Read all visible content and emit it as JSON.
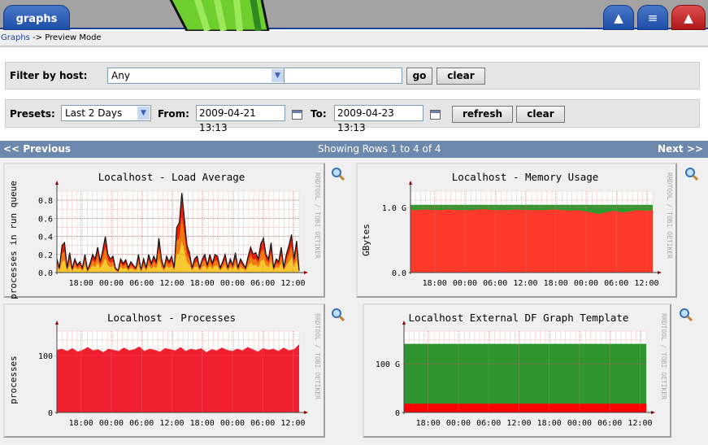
{
  "header": {
    "tab_label": "graphs",
    "icons": [
      "tree-icon",
      "list-icon",
      "graph-preview-icon"
    ]
  },
  "breadcrumb": {
    "link": "Graphs",
    "rest": " -> Preview Mode"
  },
  "filter": {
    "label": "Filter by host:",
    "host_value": "Any",
    "search_value": "",
    "go_label": "go",
    "clear_label": "clear"
  },
  "timespan": {
    "presets_label": "Presets:",
    "preset_value": "Last 2 Days",
    "from_label": "From:",
    "from_value": "2009-04-21 13:13",
    "to_label": "To:",
    "to_value": "2009-04-23 13:13",
    "refresh_label": "refresh",
    "clear_label": "clear"
  },
  "nav": {
    "previous": "<< Previous",
    "status": "Showing Rows 1 to 4 of 4",
    "next": "Next >>"
  },
  "colors": {
    "header_bg": "#a3a3a3",
    "nav_bg": "#6d88ad",
    "accent": "#1a3f9a"
  },
  "chart_data": [
    {
      "type": "area",
      "title": "Localhost - Load Average",
      "ylabel": "processes in run queue",
      "watermark": "RRDTOOL / TOBI OETIKER",
      "ylim": [
        0,
        0.9
      ],
      "yticks": [
        "0.0",
        "0.2",
        "0.4",
        "0.6",
        "0.8"
      ],
      "ytick_values": [
        0,
        0.2,
        0.4,
        0.6,
        0.8
      ],
      "xlim": [
        "2009-04-21 13:13",
        "2009-04-23 13:13"
      ],
      "xticks": [
        "18:00",
        "00:00",
        "06:00",
        "12:00",
        "18:00",
        "00:00",
        "06:00",
        "12:00"
      ],
      "values": [
        0.15,
        0.05,
        0.3,
        0.33,
        0.05,
        0.22,
        0.04,
        0.15,
        0.08,
        0.12,
        0.05,
        0.2,
        0.03,
        0.1,
        0.2,
        0.15,
        0.28,
        0.12,
        0.25,
        0.4,
        0.2,
        0.15,
        0.18,
        0.05,
        0.02,
        0.15,
        0.1,
        0.14,
        0.05,
        0.12,
        0.08,
        0.05,
        0.2,
        0.03,
        0.15,
        0.05,
        0.2,
        0.1,
        0.18,
        0.12,
        0.38,
        0.15,
        0.05,
        0.18,
        0.12,
        0.18,
        0.05,
        0.5,
        0.55,
        0.88,
        0.6,
        0.3,
        0.22,
        0.05,
        0.15,
        0.18,
        0.05,
        0.15,
        0.2,
        0.08,
        0.2,
        0.1,
        0.2,
        0.18,
        0.05,
        0.12,
        0.2,
        0.05,
        0.15,
        0.08,
        0.22,
        0.05,
        0.15,
        0.1,
        0.05,
        0.18,
        0.28,
        0.2,
        0.22,
        0.15,
        0.32,
        0.38,
        0.2,
        0.15,
        0.33,
        0.05,
        0.15,
        0.12,
        0.28,
        0.05,
        0.2,
        0.3,
        0.42,
        0.15,
        0.35,
        0.02
      ]
    },
    {
      "type": "area",
      "title": "Localhost - Memory Usage",
      "ylabel": "GBytes",
      "watermark": "RRDTOOL / TOBI OETIKER",
      "ylim": [
        0,
        1.25
      ],
      "yticks": [
        "0.0",
        "1.0 G"
      ],
      "ytick_values": [
        0,
        1.0
      ],
      "xlim": [
        "2009-04-21 13:13",
        "2009-04-23 13:13"
      ],
      "xticks": [
        "18:00",
        "00:00",
        "06:00",
        "12:00",
        "18:00",
        "00:00",
        "06:00",
        "12:00"
      ],
      "series": [
        {
          "color": "#ff3a2a",
          "values": [
            0.96,
            0.96,
            0.97,
            0.96,
            0.96,
            0.97,
            0.96,
            0.96,
            0.96,
            0.97,
            0.97,
            0.96,
            0.96,
            0.96,
            0.97,
            0.96,
            0.96,
            0.96,
            0.96,
            0.97,
            0.96,
            0.95,
            0.96,
            0.94,
            0.92,
            0.9,
            0.93,
            0.95,
            0.92,
            0.94,
            0.96,
            0.95,
            0.96
          ]
        },
        {
          "color": "#2f9a2f",
          "values": [
            1.04,
            1.04,
            1.04,
            1.04,
            1.04,
            1.04,
            1.04,
            1.04,
            1.04,
            1.04,
            1.04,
            1.04,
            1.04,
            1.04,
            1.04,
            1.04,
            1.04,
            1.04,
            1.04,
            1.04,
            1.04,
            1.04,
            1.04,
            1.04,
            1.04,
            1.04,
            1.04,
            1.04,
            1.04,
            1.04,
            1.04,
            1.04,
            1.04
          ]
        }
      ]
    },
    {
      "type": "area",
      "title": "Localhost - Processes",
      "ylabel": "processes",
      "watermark": "RRDTOOL / TOBI OETIKER",
      "ylim": [
        0,
        143
      ],
      "yticks": [
        "0",
        "100"
      ],
      "ytick_values": [
        0,
        100
      ],
      "xlim": [
        "2009-04-21 13:13",
        "2009-04-23 13:13"
      ],
      "xticks": [
        "18:00",
        "00:00",
        "06:00",
        "12:00",
        "18:00",
        "00:00",
        "06:00",
        "12:00"
      ],
      "series": [
        {
          "color": "#f02030",
          "values": [
            110,
            112,
            108,
            113,
            107,
            110,
            115,
            109,
            111,
            106,
            112,
            110,
            108,
            114,
            109,
            111,
            116,
            108,
            112,
            110,
            107,
            113,
            111,
            109,
            115,
            108,
            112,
            110,
            113,
            106,
            111,
            109,
            114,
            110,
            108,
            112,
            109,
            115,
            111,
            107,
            113,
            110,
            112,
            108,
            114,
            109,
            111,
            120
          ]
        }
      ]
    },
    {
      "type": "area",
      "title": "Localhost External DF Graph Template",
      "ylabel": "",
      "watermark": "RRDTOOL / TOBI OETIKER",
      "ylim": [
        0,
        167
      ],
      "yticks": [
        "0",
        "100 G"
      ],
      "ytick_values": [
        0,
        100
      ],
      "xlim": [
        "2009-04-21 13:13",
        "2009-04-23 13:13"
      ],
      "xticks": [
        "18:00",
        "00:00",
        "06:00",
        "12:00",
        "18:00",
        "00:00",
        "06:00",
        "12:00"
      ],
      "series": [
        {
          "color": "#ff0000",
          "values": [
            18,
            18
          ]
        },
        {
          "color": "#2f962f",
          "values": [
            141,
            141
          ]
        }
      ]
    }
  ]
}
